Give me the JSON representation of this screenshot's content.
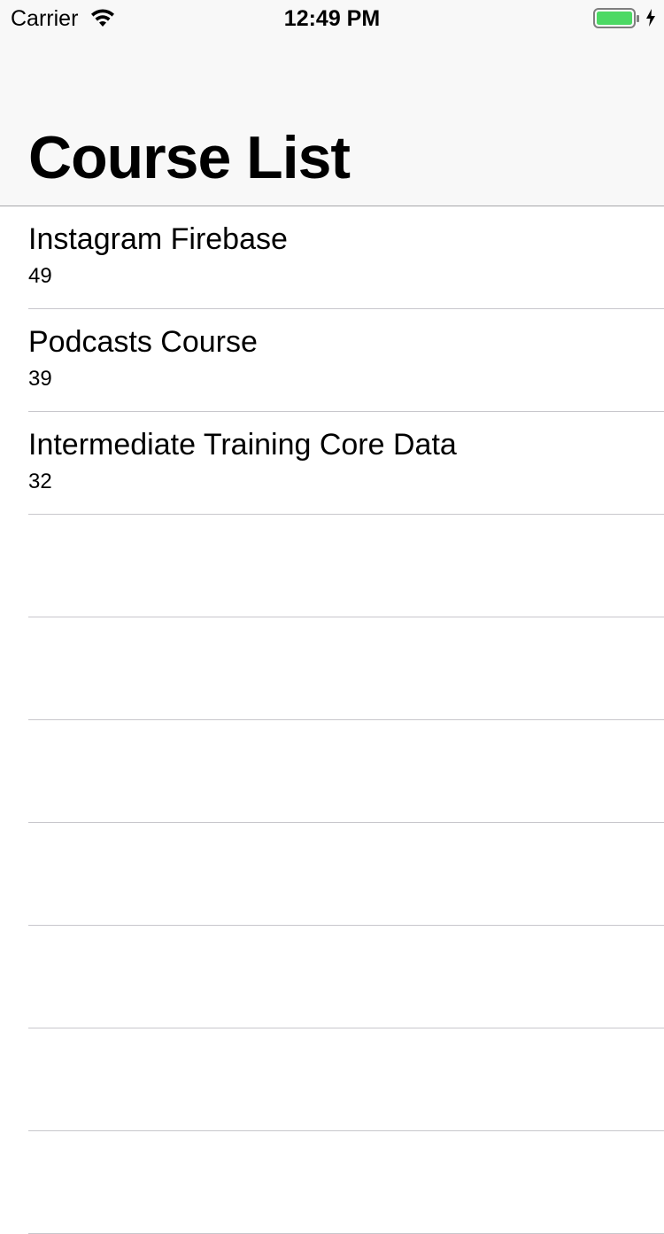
{
  "status_bar": {
    "carrier": "Carrier",
    "time": "12:49 PM",
    "wifi_icon": "wifi-icon",
    "battery_icon": "battery-icon",
    "charging_icon": "charging-bolt-icon",
    "battery_color": "#4cd964"
  },
  "navbar": {
    "title": "Course List",
    "background": "#f8f8f8"
  },
  "courses": [
    {
      "title": "Instagram Firebase",
      "subtitle": "49"
    },
    {
      "title": "Podcasts Course",
      "subtitle": "39"
    },
    {
      "title": "Intermediate Training Core Data",
      "subtitle": "32"
    }
  ]
}
